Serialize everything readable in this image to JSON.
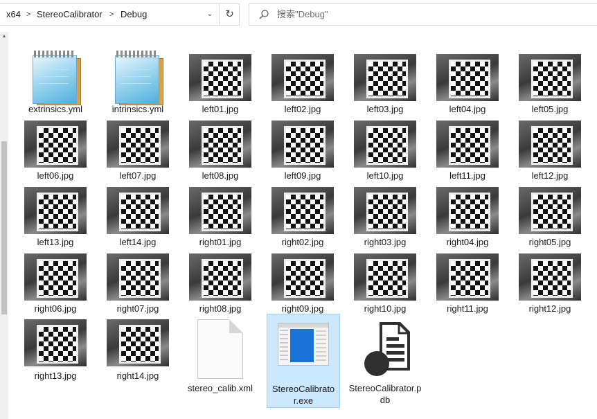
{
  "address_bar": {
    "crumbs": [
      "x64",
      "StereoCalibrator",
      "Debug"
    ],
    "separator": ">",
    "dropdown_glyph": "⌄",
    "refresh_glyph": "↻"
  },
  "search": {
    "placeholder": "搜索\"Debug\""
  },
  "files": [
    {
      "name": "extrinsics.yml",
      "icon": "notepad"
    },
    {
      "name": "intrinsics.yml",
      "icon": "notepad"
    },
    {
      "name": "left01.jpg",
      "icon": "photo"
    },
    {
      "name": "left02.jpg",
      "icon": "photo"
    },
    {
      "name": "left03.jpg",
      "icon": "photo"
    },
    {
      "name": "left04.jpg",
      "icon": "photo"
    },
    {
      "name": "left05.jpg",
      "icon": "photo"
    },
    {
      "name": "left06.jpg",
      "icon": "photo"
    },
    {
      "name": "left07.jpg",
      "icon": "photo"
    },
    {
      "name": "left08.jpg",
      "icon": "photo"
    },
    {
      "name": "left09.jpg",
      "icon": "photo"
    },
    {
      "name": "left10.jpg",
      "icon": "photo"
    },
    {
      "name": "left11.jpg",
      "icon": "photo"
    },
    {
      "name": "left12.jpg",
      "icon": "photo"
    },
    {
      "name": "left13.jpg",
      "icon": "photo"
    },
    {
      "name": "left14.jpg",
      "icon": "photo"
    },
    {
      "name": "right01.jpg",
      "icon": "photo"
    },
    {
      "name": "right02.jpg",
      "icon": "photo"
    },
    {
      "name": "right03.jpg",
      "icon": "photo"
    },
    {
      "name": "right04.jpg",
      "icon": "photo"
    },
    {
      "name": "right05.jpg",
      "icon": "photo"
    },
    {
      "name": "right06.jpg",
      "icon": "photo"
    },
    {
      "name": "right07.jpg",
      "icon": "photo"
    },
    {
      "name": "right08.jpg",
      "icon": "photo"
    },
    {
      "name": "right09.jpg",
      "icon": "photo"
    },
    {
      "name": "right10.jpg",
      "icon": "photo"
    },
    {
      "name": "right11.jpg",
      "icon": "photo"
    },
    {
      "name": "right12.jpg",
      "icon": "photo"
    },
    {
      "name": "right13.jpg",
      "icon": "photo"
    },
    {
      "name": "right14.jpg",
      "icon": "photo"
    },
    {
      "name": "stereo_calib.xml",
      "icon": "xml-document"
    },
    {
      "name": "StereoCalibrator.exe",
      "icon": "application",
      "selected": true
    },
    {
      "name": "StereoCalibrator.pdb",
      "icon": "pdb-document"
    }
  ],
  "colors": {
    "selection_bg": "#cce8ff",
    "selection_border": "#99d1ff",
    "exe_accent": "#1a73d9"
  }
}
